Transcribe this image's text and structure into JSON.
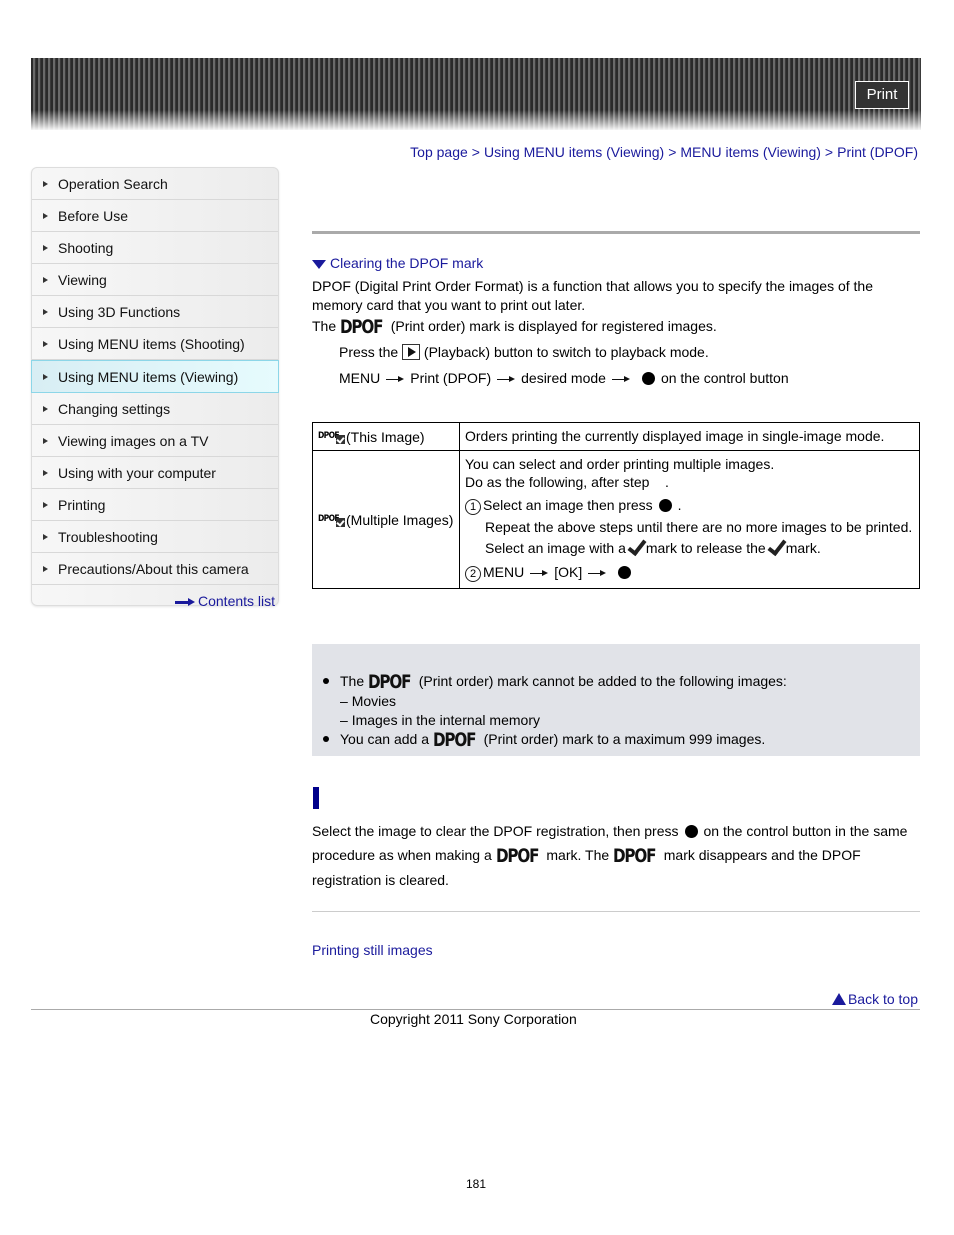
{
  "header": {
    "print_label": "Print"
  },
  "breadcrumb": [
    "Top page",
    "Using MENU items (Viewing)",
    "MENU items (Viewing)",
    "Print (DPOF)"
  ],
  "breadcrumb_separator": ">",
  "sidebar": {
    "items": [
      {
        "label": "Operation Search",
        "active": false
      },
      {
        "label": "Before Use",
        "active": false
      },
      {
        "label": "Shooting",
        "active": false
      },
      {
        "label": "Viewing",
        "active": false
      },
      {
        "label": "Using 3D Functions",
        "active": false
      },
      {
        "label": "Using MENU items (Shooting)",
        "active": false
      },
      {
        "label": "Using MENU items (Viewing)",
        "active": true
      },
      {
        "label": "Changing settings",
        "active": false
      },
      {
        "label": "Viewing images on a TV",
        "active": false
      },
      {
        "label": "Using with your computer",
        "active": false
      },
      {
        "label": "Printing",
        "active": false
      },
      {
        "label": "Troubleshooting",
        "active": false
      },
      {
        "label": "Precautions/About this camera",
        "active": false
      }
    ],
    "contents_link": "Contents list"
  },
  "main": {
    "anchor_link": "Clearing the DPOF mark",
    "intro_line1": "DPOF (Digital Print Order Format) is a function that allows you to specify the images of the memory card that you want to print out later.",
    "intro_line2_pre": "The",
    "dpof_mark": "DPOF",
    "intro_line2_post": "(Print order) mark is displayed for registered images.",
    "step1_pre": "Press the",
    "step1_post": "(Playback) button to switch to playback mode.",
    "step2": [
      "MENU",
      "Print (DPOF)",
      "desired mode",
      "on the control button"
    ],
    "table": {
      "row1": {
        "mode": "(This Image)",
        "desc": "Orders printing the currently displayed image in single-image mode."
      },
      "row2": {
        "mode": "(Multiple Images)",
        "line1": "You can select and order printing multiple images.",
        "line2": "Do as the following, after step    .",
        "sub1_num": "1",
        "sub1_text": "Select an image then press",
        "sub1_end": ".",
        "sub1_note1": "Repeat the above steps until there are no more images to be printed.",
        "sub1_note2_pre": "Select an image with a",
        "sub1_note2_mid": "mark to release the",
        "sub1_note2_post": "mark.",
        "sub2_num": "2",
        "sub2_parts": [
          "MENU",
          "[OK]"
        ]
      }
    },
    "notes": {
      "n1_pre": "The",
      "n1_post": "(Print order) mark cannot be added to the following images:",
      "n1_subs": [
        "Movies",
        "Images in the internal memory"
      ],
      "n2_pre": "You can add a",
      "n2_post": "(Print order) mark to a maximum 999 images."
    },
    "clear": {
      "p1": "Select the image to clear the DPOF registration, then press",
      "p2": "on the control button in the same procedure as when making a",
      "p3": "mark. The",
      "p4": "mark disappears and the DPOF registration is cleared."
    },
    "related_link": "Printing still images",
    "back_to_top": "Back to top"
  },
  "footer": {
    "copyright": "Copyright 2011 Sony Corporation",
    "page_number": "181"
  }
}
